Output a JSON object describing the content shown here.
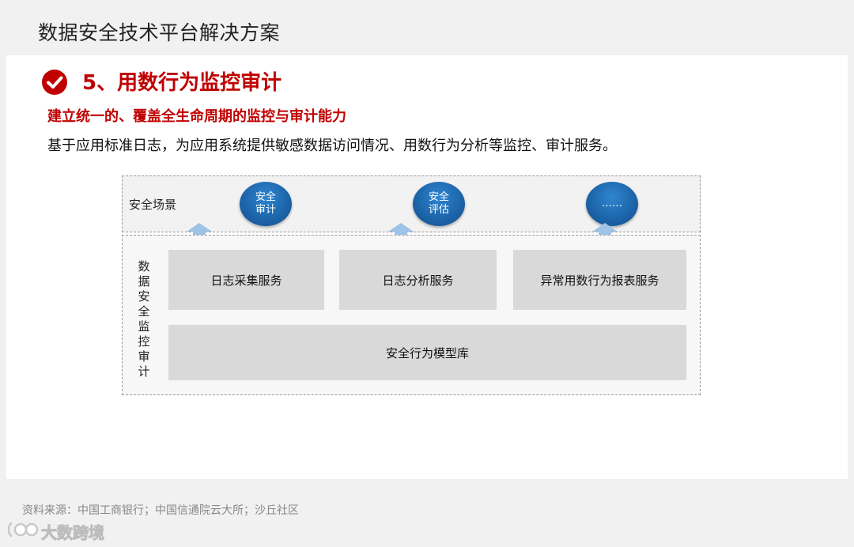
{
  "header": {
    "title": "数据安全技术平台解决方案"
  },
  "section": {
    "title": "5、用数行为监控审计",
    "subtitle": "建立统一的、覆盖全生命周期的监控与审计能力",
    "description": "基于应用标准日志，为应用系统提供敏感数据访问情况、用数行为分析等监控、审计服务。"
  },
  "diagram": {
    "scene_label": "安全场景",
    "scenes": [
      {
        "label": "安全审计"
      },
      {
        "label": "安全评估"
      },
      {
        "label": "……"
      }
    ],
    "layer_label": "数据安全监控审计",
    "services": [
      {
        "label": "日志采集服务"
      },
      {
        "label": "日志分析服务"
      },
      {
        "label": "异常用数行为报表服务"
      }
    ],
    "model_library": "安全行为模型库"
  },
  "footer": {
    "source": "资料来源：中国工商银行；中国信通院云大所；沙丘社区",
    "watermark": "大数跨境"
  },
  "colors": {
    "accent_red": "#c00000",
    "circle_blue": "#1c63a8",
    "arrow_blue": "#9dc3e6",
    "service_gray": "#d9d9d9"
  }
}
